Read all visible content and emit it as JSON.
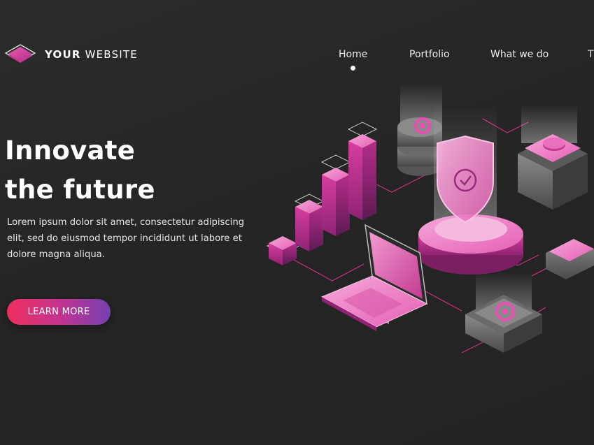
{
  "header": {
    "logo_icon": "layered-diamond-icon",
    "brand_bold": "YOUR",
    "brand_light": " WEBSITE"
  },
  "nav": {
    "items": [
      {
        "label": "Home",
        "active": true
      },
      {
        "label": "Portfolio",
        "active": false
      },
      {
        "label": "What we do",
        "active": false
      },
      {
        "label": "T",
        "active": false
      }
    ]
  },
  "hero": {
    "title_line1": "Innovate",
    "title_line2": "the future",
    "description": "Lorem ipsum dolor sit amet, consectetur adipiscing elit, sed do eiusmod tempor incididunt ut labore et dolore magna aliqua.",
    "cta_label": "LEARN MORE"
  },
  "colors": {
    "background": "#262626",
    "accent_pink": "#e84fb2",
    "gradient_start": "#ef2e5e",
    "gradient_end": "#7340b0"
  },
  "illustration": {
    "icons": [
      "bar-chart-icon",
      "database-gear-icon",
      "shield-check-icon",
      "laptop-dashboard-icon",
      "server-stack-icon",
      "gear-server-icon"
    ]
  }
}
